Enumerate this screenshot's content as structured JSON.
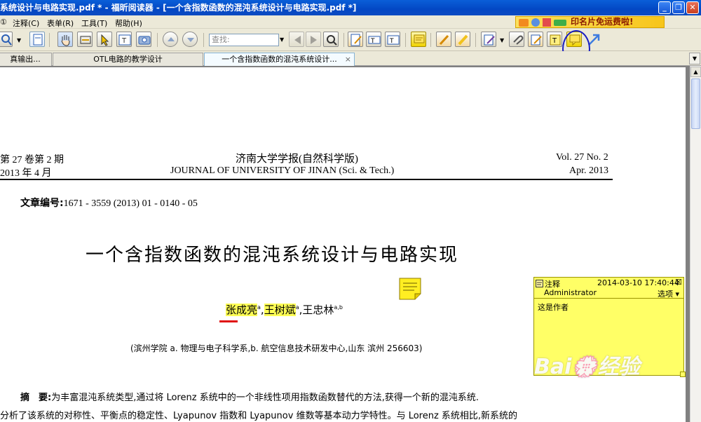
{
  "window": {
    "title": "系统设计与电路实现.pdf * - 福昕阅读器 - [一个含指数函数的混沌系统设计与电路实现.pdf *]",
    "minimize": "_",
    "restore": "❐",
    "close": "✕"
  },
  "menu": {
    "items": [
      "注释(C)",
      "表单(R)",
      "工具(T)",
      "帮助(H)"
    ],
    "partial_left": "①"
  },
  "promo": {
    "text": "印名片免运费啦!"
  },
  "search": {
    "placeholder": "查找:"
  },
  "tabs": [
    {
      "label": "真输出..."
    },
    {
      "label": "OTL电路的教学设计"
    },
    {
      "label": "一个含指数函数的混沌系统设计...",
      "close": "×"
    }
  ],
  "tab_dropdown": "▼",
  "document": {
    "header_left_1": "第 27 卷第 2 期",
    "header_left_2": "2013 年 4 月",
    "header_center_1": "济南大学学报(自然科学版)",
    "header_center_2": "JOURNAL OF UNIVERSITY OF JINAN (Sci. & Tech.)",
    "header_right_1": "Vol. 27 No. 2",
    "header_right_2": "Apr. 2013",
    "article_no_label": "文章编号:",
    "article_no": "1671 - 3559 (2013) 01 - 0140 - 05",
    "title": "一个含指数函数的混沌系统设计与电路实现",
    "author1": "张成亮",
    "author1_sup": "a",
    "author2": "王树斌",
    "author2_sup": "a",
    "author3": "王忠林",
    "author3_sup": "a,b",
    "affiliation": "(滨州学院 a. 物理与电子科学系,b. 航空信息技术研发中心,山东 滨州 256603)",
    "abstract_label": "摘　要:",
    "abstract_line1": "为丰富混沌系统类型,通过将 Lorenz 系统中的一个非线性项用指数函数替代的方法,获得一个新的混沌系统.",
    "abstract_line2": "分析了该系统的对称性、平衡点的稳定性、Lyapunov 指数和 Lyapunov 维数等基本动力学特性。与 Lorenz 系统相比,新系统的"
  },
  "note_popup": {
    "type_label": "注释",
    "datetime": "2014-03-10 17:40:44",
    "close": "☒",
    "author": "Administrator",
    "options": "选项 ▾",
    "content": "这是作者"
  },
  "watermark": {
    "text": "Bai💮经验"
  },
  "colors": {
    "titlebar": "#0347c4",
    "note_yellow": "#ffff66",
    "highlight_circle": "#1a1ec2",
    "underline_red": "#e01010"
  }
}
